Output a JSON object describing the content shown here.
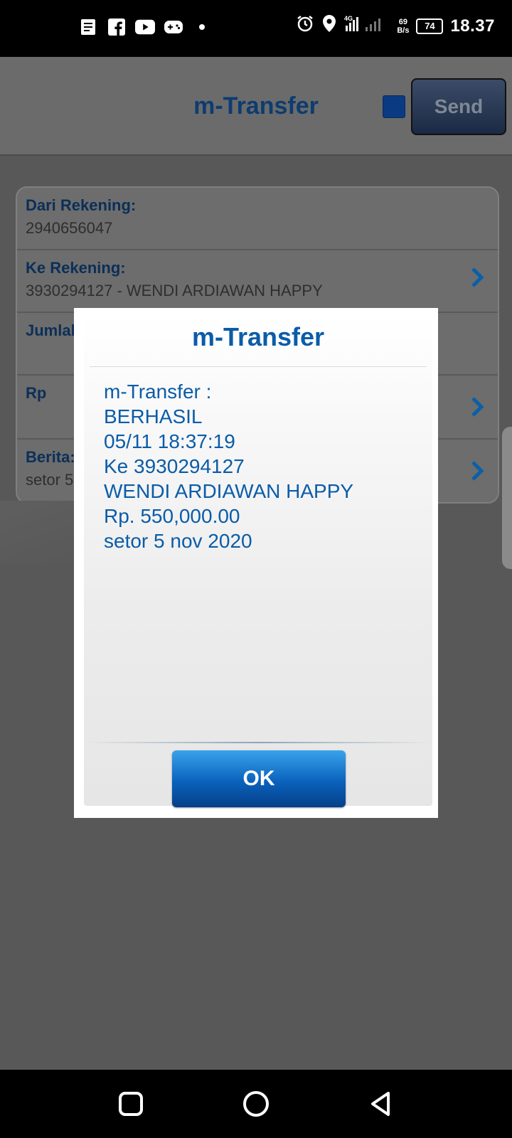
{
  "status_bar": {
    "time": "18.37",
    "battery": "74",
    "net_speed_value": "69",
    "net_speed_unit": "B/s",
    "network": "4G"
  },
  "header": {
    "title": "m-Transfer",
    "send_label": "Send"
  },
  "form": {
    "rows": [
      {
        "label": "Dari Rekening:",
        "value": "2940656047"
      },
      {
        "label": "Ke Rekening:",
        "value": "3930294127 - WENDI ARDIAWAN HAPPY"
      },
      {
        "label": "Jumlah",
        "value": ""
      },
      {
        "label": "Rp",
        "value": ""
      },
      {
        "label": "Berita:",
        "value": "setor 5"
      }
    ]
  },
  "dialog": {
    "title": "m-Transfer",
    "lines": [
      "m-Transfer :",
      "BERHASIL",
      "05/11 18:37:19",
      "Ke 3930294127",
      "WENDI ARDIAWAN HAPPY",
      "Rp. 550,000.00",
      "setor 5 nov 2020"
    ],
    "ok_label": "OK"
  },
  "colors": {
    "accent": "#0a5ca8",
    "header_title": "#0d3c70",
    "ok_button": "#0a62bc"
  }
}
